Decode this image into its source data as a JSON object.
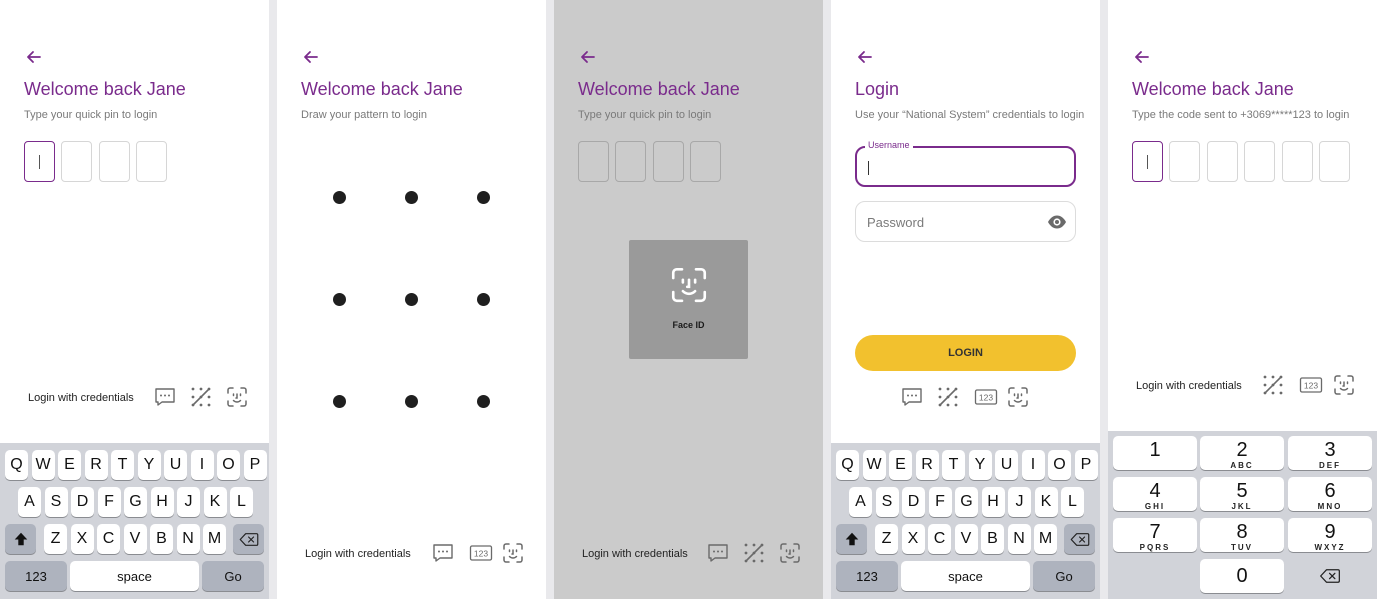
{
  "colors": {
    "accent": "#7a2b8c",
    "button": "#f2c12e",
    "keyboard": "#d1d3d9",
    "overlay": "#cbcbcb"
  },
  "icons": [
    "arrow-left-icon",
    "message-icon",
    "pattern-icon",
    "pin-123-icon",
    "face-id-icon",
    "eye-icon",
    "shift-icon",
    "backspace-icon"
  ],
  "screen_pin": {
    "title": "Welcome back Jane",
    "subtitle": "Type your quick pin to login",
    "credentials_link": "Login with credentials"
  },
  "screen_pattern": {
    "title": "Welcome back Jane",
    "subtitle": "Draw your pattern to login",
    "credentials_link": "Login with credentials"
  },
  "screen_faceid": {
    "title": "Welcome back Jane",
    "subtitle": "Type your quick pin to login",
    "face_id_label": "Face ID",
    "credentials_link": "Login with credentials"
  },
  "screen_login": {
    "title": "Login",
    "subtitle": "Use your “National System” credentials to login",
    "username_label": "Username",
    "password_placeholder": "Password",
    "login_button": "LOGIN"
  },
  "screen_otp": {
    "title": "Welcome back Jane",
    "subtitle": "Type the code sent to +3069*****123 to login",
    "credentials_link": "Login with credentials"
  },
  "keyboard": {
    "row1": [
      "Q",
      "W",
      "E",
      "R",
      "T",
      "Y",
      "U",
      "I",
      "O",
      "P"
    ],
    "row2": [
      "A",
      "S",
      "D",
      "F",
      "G",
      "H",
      "J",
      "K",
      "L"
    ],
    "row3": [
      "Z",
      "X",
      "C",
      "V",
      "B",
      "N",
      "M"
    ],
    "numbers_key": "123",
    "space_key": "space",
    "go_key": "Go"
  },
  "numpad": {
    "keys": [
      {
        "n": "1",
        "l": ""
      },
      {
        "n": "2",
        "l": "ABC"
      },
      {
        "n": "3",
        "l": "DEF"
      },
      {
        "n": "4",
        "l": "GHI"
      },
      {
        "n": "5",
        "l": "JKL"
      },
      {
        "n": "6",
        "l": "MNO"
      },
      {
        "n": "7",
        "l": "PQRS"
      },
      {
        "n": "8",
        "l": "TUV"
      },
      {
        "n": "9",
        "l": "WXYZ"
      }
    ],
    "zero": "0"
  }
}
